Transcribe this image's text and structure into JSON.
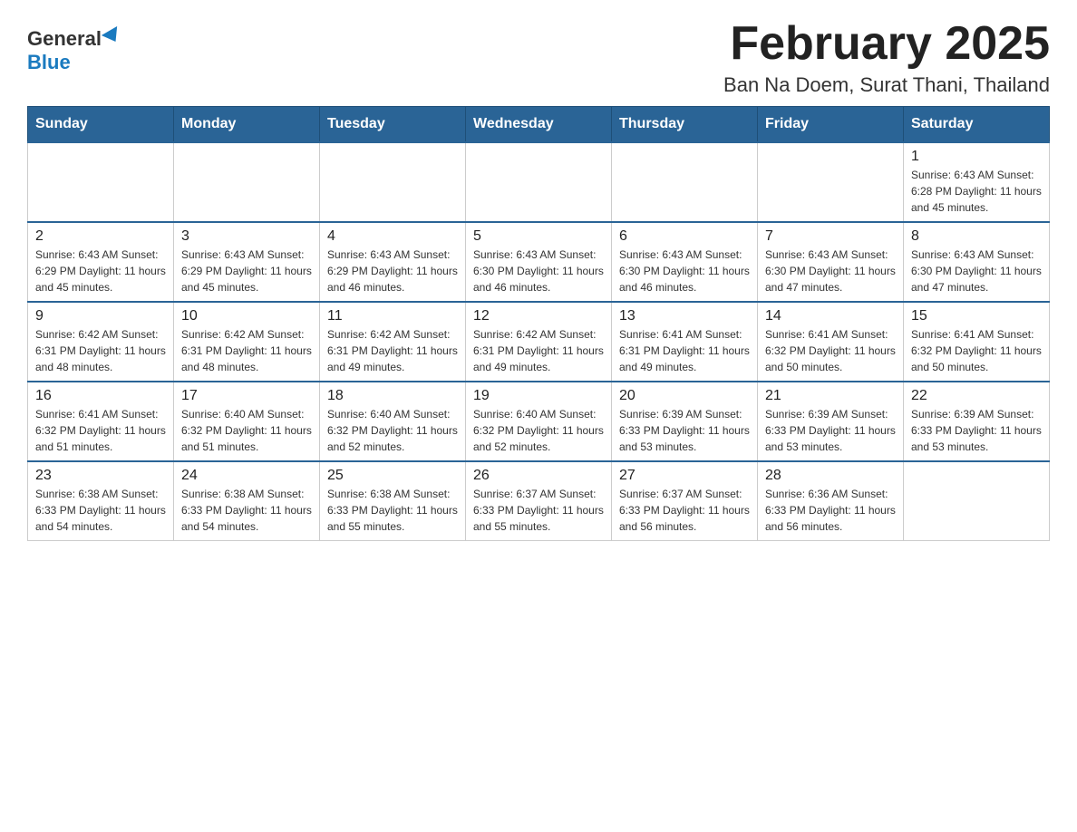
{
  "header": {
    "logo_general": "General",
    "logo_blue": "Blue",
    "main_title": "February 2025",
    "subtitle": "Ban Na Doem, Surat Thani, Thailand"
  },
  "days_of_week": [
    "Sunday",
    "Monday",
    "Tuesday",
    "Wednesday",
    "Thursday",
    "Friday",
    "Saturday"
  ],
  "weeks": [
    {
      "days": [
        {
          "num": "",
          "info": ""
        },
        {
          "num": "",
          "info": ""
        },
        {
          "num": "",
          "info": ""
        },
        {
          "num": "",
          "info": ""
        },
        {
          "num": "",
          "info": ""
        },
        {
          "num": "",
          "info": ""
        },
        {
          "num": "1",
          "info": "Sunrise: 6:43 AM\nSunset: 6:28 PM\nDaylight: 11 hours\nand 45 minutes."
        }
      ]
    },
    {
      "days": [
        {
          "num": "2",
          "info": "Sunrise: 6:43 AM\nSunset: 6:29 PM\nDaylight: 11 hours\nand 45 minutes."
        },
        {
          "num": "3",
          "info": "Sunrise: 6:43 AM\nSunset: 6:29 PM\nDaylight: 11 hours\nand 45 minutes."
        },
        {
          "num": "4",
          "info": "Sunrise: 6:43 AM\nSunset: 6:29 PM\nDaylight: 11 hours\nand 46 minutes."
        },
        {
          "num": "5",
          "info": "Sunrise: 6:43 AM\nSunset: 6:30 PM\nDaylight: 11 hours\nand 46 minutes."
        },
        {
          "num": "6",
          "info": "Sunrise: 6:43 AM\nSunset: 6:30 PM\nDaylight: 11 hours\nand 46 minutes."
        },
        {
          "num": "7",
          "info": "Sunrise: 6:43 AM\nSunset: 6:30 PM\nDaylight: 11 hours\nand 47 minutes."
        },
        {
          "num": "8",
          "info": "Sunrise: 6:43 AM\nSunset: 6:30 PM\nDaylight: 11 hours\nand 47 minutes."
        }
      ]
    },
    {
      "days": [
        {
          "num": "9",
          "info": "Sunrise: 6:42 AM\nSunset: 6:31 PM\nDaylight: 11 hours\nand 48 minutes."
        },
        {
          "num": "10",
          "info": "Sunrise: 6:42 AM\nSunset: 6:31 PM\nDaylight: 11 hours\nand 48 minutes."
        },
        {
          "num": "11",
          "info": "Sunrise: 6:42 AM\nSunset: 6:31 PM\nDaylight: 11 hours\nand 49 minutes."
        },
        {
          "num": "12",
          "info": "Sunrise: 6:42 AM\nSunset: 6:31 PM\nDaylight: 11 hours\nand 49 minutes."
        },
        {
          "num": "13",
          "info": "Sunrise: 6:41 AM\nSunset: 6:31 PM\nDaylight: 11 hours\nand 49 minutes."
        },
        {
          "num": "14",
          "info": "Sunrise: 6:41 AM\nSunset: 6:32 PM\nDaylight: 11 hours\nand 50 minutes."
        },
        {
          "num": "15",
          "info": "Sunrise: 6:41 AM\nSunset: 6:32 PM\nDaylight: 11 hours\nand 50 minutes."
        }
      ]
    },
    {
      "days": [
        {
          "num": "16",
          "info": "Sunrise: 6:41 AM\nSunset: 6:32 PM\nDaylight: 11 hours\nand 51 minutes."
        },
        {
          "num": "17",
          "info": "Sunrise: 6:40 AM\nSunset: 6:32 PM\nDaylight: 11 hours\nand 51 minutes."
        },
        {
          "num": "18",
          "info": "Sunrise: 6:40 AM\nSunset: 6:32 PM\nDaylight: 11 hours\nand 52 minutes."
        },
        {
          "num": "19",
          "info": "Sunrise: 6:40 AM\nSunset: 6:32 PM\nDaylight: 11 hours\nand 52 minutes."
        },
        {
          "num": "20",
          "info": "Sunrise: 6:39 AM\nSunset: 6:33 PM\nDaylight: 11 hours\nand 53 minutes."
        },
        {
          "num": "21",
          "info": "Sunrise: 6:39 AM\nSunset: 6:33 PM\nDaylight: 11 hours\nand 53 minutes."
        },
        {
          "num": "22",
          "info": "Sunrise: 6:39 AM\nSunset: 6:33 PM\nDaylight: 11 hours\nand 53 minutes."
        }
      ]
    },
    {
      "days": [
        {
          "num": "23",
          "info": "Sunrise: 6:38 AM\nSunset: 6:33 PM\nDaylight: 11 hours\nand 54 minutes."
        },
        {
          "num": "24",
          "info": "Sunrise: 6:38 AM\nSunset: 6:33 PM\nDaylight: 11 hours\nand 54 minutes."
        },
        {
          "num": "25",
          "info": "Sunrise: 6:38 AM\nSunset: 6:33 PM\nDaylight: 11 hours\nand 55 minutes."
        },
        {
          "num": "26",
          "info": "Sunrise: 6:37 AM\nSunset: 6:33 PM\nDaylight: 11 hours\nand 55 minutes."
        },
        {
          "num": "27",
          "info": "Sunrise: 6:37 AM\nSunset: 6:33 PM\nDaylight: 11 hours\nand 56 minutes."
        },
        {
          "num": "28",
          "info": "Sunrise: 6:36 AM\nSunset: 6:33 PM\nDaylight: 11 hours\nand 56 minutes."
        },
        {
          "num": "",
          "info": ""
        }
      ]
    }
  ]
}
